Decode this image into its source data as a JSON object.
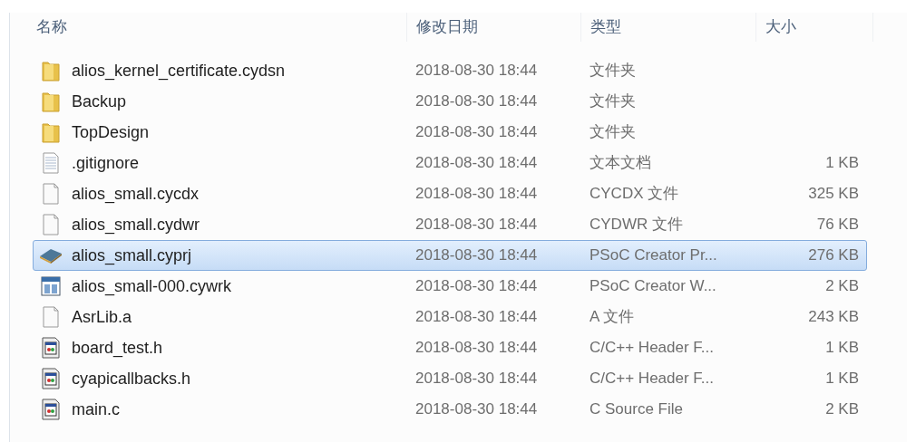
{
  "columns": [
    "名称",
    "修改日期",
    "类型",
    "大小"
  ],
  "rows": [
    {
      "kind": "folder",
      "name": "alios_kernel_certificate.cydsn",
      "date": "2018-08-30 18:44",
      "type": "文件夹",
      "selected": false
    },
    {
      "kind": "folder",
      "name": "Backup",
      "date": "2018-08-30 18:44",
      "type": "文件夹",
      "selected": false
    },
    {
      "kind": "folder",
      "name": "TopDesign",
      "date": "2018-08-30 18:44",
      "type": "文件夹",
      "selected": false
    },
    {
      "kind": "text",
      "name": ".gitignore",
      "date": "2018-08-30 18:44",
      "type": "文本文档",
      "size": "1 KB",
      "selected": false
    },
    {
      "kind": "blank",
      "name": "alios_small.cycdx",
      "date": "2018-08-30 18:44",
      "type": "CYCDX 文件",
      "size": "325 KB",
      "selected": false
    },
    {
      "kind": "blank",
      "name": "alios_small.cydwr",
      "date": "2018-08-30 18:44",
      "type": "CYDWR 文件",
      "size": "76 KB",
      "selected": false
    },
    {
      "kind": "project",
      "name": "alios_small.cyprj",
      "date": "2018-08-30 18:44",
      "type": "PSoC Creator Pr...",
      "size": "276 KB",
      "selected": true
    },
    {
      "kind": "workspace",
      "name": "alios_small-000.cywrk",
      "date": "2018-08-30 18:44",
      "type": "PSoC Creator W...",
      "size": "2 KB",
      "selected": false
    },
    {
      "kind": "blank",
      "name": "AsrLib.a",
      "date": "2018-08-30 18:44",
      "type": "A 文件",
      "size": "243 KB",
      "selected": false
    },
    {
      "kind": "source",
      "name": "board_test.h",
      "date": "2018-08-30 18:44",
      "type": "C/C++ Header F...",
      "size": "1 KB",
      "selected": false
    },
    {
      "kind": "source",
      "name": "cyapicallbacks.h",
      "date": "2018-08-30 18:44",
      "type": "C/C++ Header F...",
      "size": "1 KB",
      "selected": false
    },
    {
      "kind": "source",
      "name": "main.c",
      "date": "2018-08-30 18:44",
      "type": "C Source File",
      "size": "2 KB",
      "selected": false
    }
  ]
}
